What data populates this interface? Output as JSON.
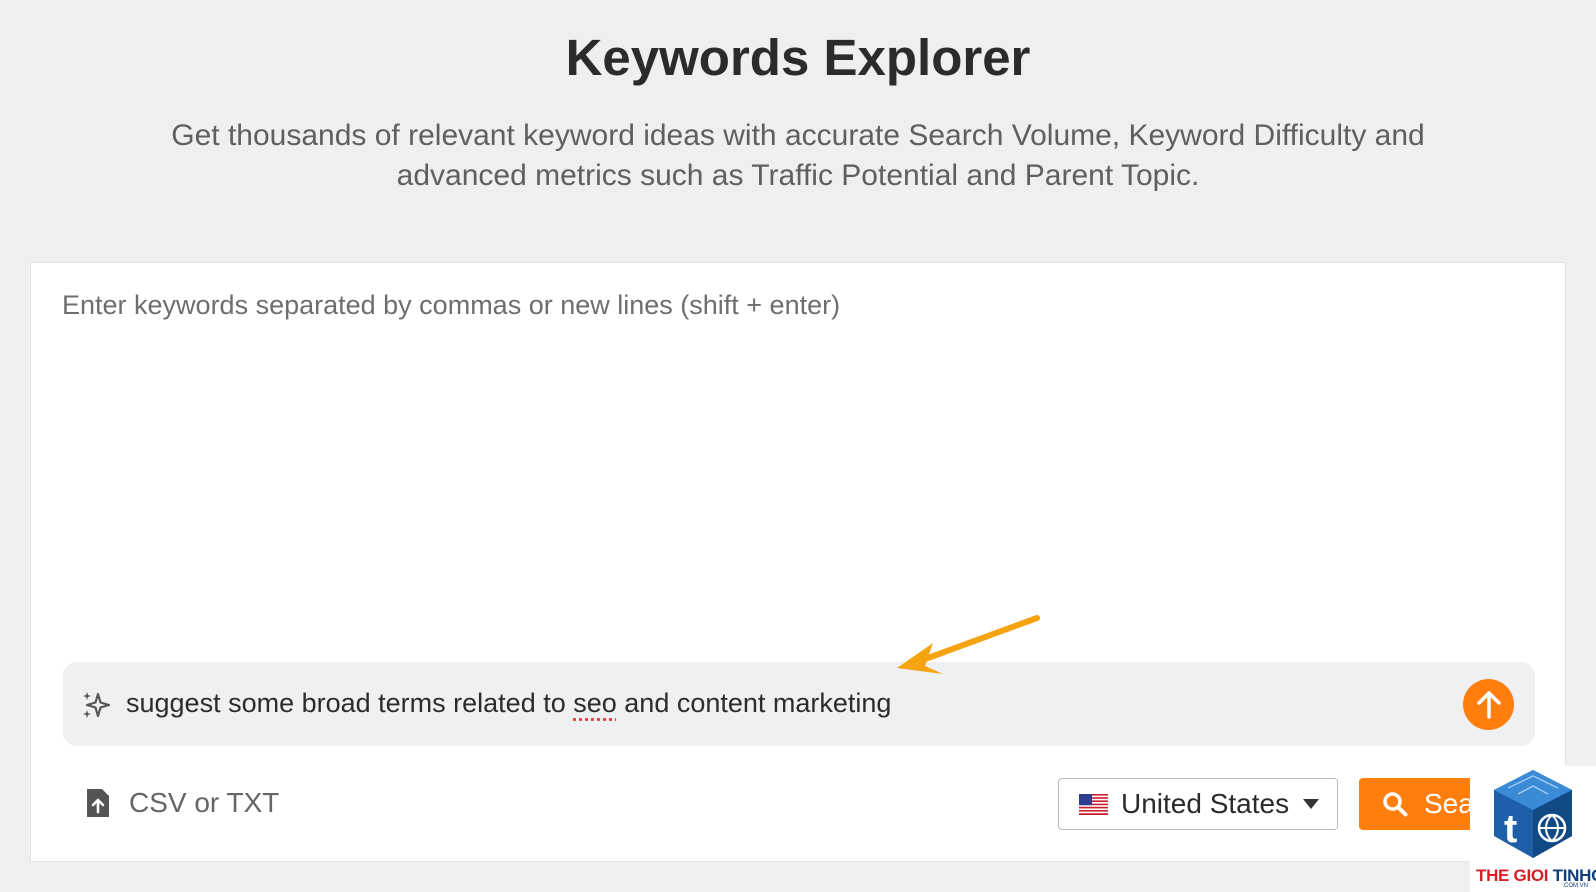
{
  "header": {
    "title": "Keywords Explorer",
    "subtitle": "Get thousands of relevant keyword ideas with accurate Search Volume, Keyword Difficulty and advanced metrics such as Traffic Potential and Parent Topic."
  },
  "keyword_input": {
    "placeholder": "Enter keywords separated by commas or new lines (shift + enter)",
    "value": ""
  },
  "ai_prompt": {
    "icon": "sparkle-icon",
    "text_before": "suggest some broad terms related to ",
    "text_flagged": "seo",
    "text_after": " and content marketing",
    "submit_icon": "arrow-up-icon"
  },
  "upload": {
    "icon": "file-upload-icon",
    "label": "CSV or TXT"
  },
  "country_select": {
    "flag_icon": "us-flag-icon",
    "selected": "United States"
  },
  "search_button": {
    "icon": "search-icon",
    "label": "Search"
  },
  "watermark": {
    "brand_part1": "THE GIOI",
    "brand_part2": " TINHOC",
    "domain": ".COM.VN"
  },
  "colors": {
    "accent": "#ff7e0e",
    "annotation_arrow": "#f5a30f",
    "background": "#eeeff1",
    "card": "#ffffff",
    "watermark_red": "#d81f26",
    "watermark_blue": "#0d3e78"
  }
}
